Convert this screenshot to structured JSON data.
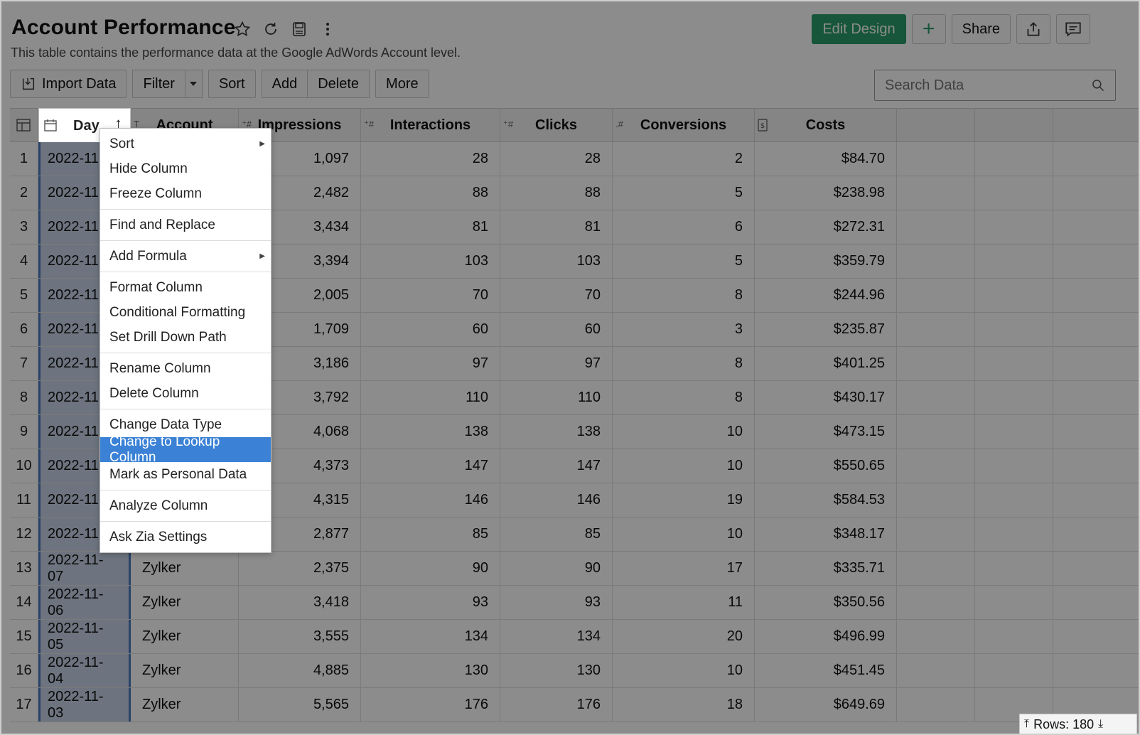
{
  "header": {
    "title": "Account Performance",
    "subtitle": "This table contains the performance data at the Google AdWords Account level."
  },
  "top_actions": {
    "edit_design": "Edit Design",
    "add": "+",
    "share": "Share"
  },
  "toolbar": {
    "import_data": "Import Data",
    "filter": "Filter",
    "sort": "Sort",
    "add": "Add",
    "delete": "Delete",
    "more": "More"
  },
  "search": {
    "placeholder": "Search Data"
  },
  "columns": {
    "day": "Day",
    "account": "Account",
    "impressions": "Impressions",
    "interactions": "Interactions",
    "clicks": "Clicks",
    "conversions": "Conversions",
    "costs": "Costs"
  },
  "rows": [
    {
      "idx": "1",
      "day": "2022-11",
      "acct": "",
      "imp": "1,097",
      "int": "28",
      "clk": "28",
      "conv": "2",
      "cost": "$84.70"
    },
    {
      "idx": "2",
      "day": "2022-11",
      "acct": "",
      "imp": "2,482",
      "int": "88",
      "clk": "88",
      "conv": "5",
      "cost": "$238.98"
    },
    {
      "idx": "3",
      "day": "2022-11",
      "acct": "",
      "imp": "3,434",
      "int": "81",
      "clk": "81",
      "conv": "6",
      "cost": "$272.31"
    },
    {
      "idx": "4",
      "day": "2022-11",
      "acct": "",
      "imp": "3,394",
      "int": "103",
      "clk": "103",
      "conv": "5",
      "cost": "$359.79"
    },
    {
      "idx": "5",
      "day": "2022-11",
      "acct": "",
      "imp": "2,005",
      "int": "70",
      "clk": "70",
      "conv": "8",
      "cost": "$244.96"
    },
    {
      "idx": "6",
      "day": "2022-11",
      "acct": "",
      "imp": "1,709",
      "int": "60",
      "clk": "60",
      "conv": "3",
      "cost": "$235.87"
    },
    {
      "idx": "7",
      "day": "2022-11",
      "acct": "",
      "imp": "3,186",
      "int": "97",
      "clk": "97",
      "conv": "8",
      "cost": "$401.25"
    },
    {
      "idx": "8",
      "day": "2022-11",
      "acct": "",
      "imp": "3,792",
      "int": "110",
      "clk": "110",
      "conv": "8",
      "cost": "$430.17"
    },
    {
      "idx": "9",
      "day": "2022-11",
      "acct": "",
      "imp": "4,068",
      "int": "138",
      "clk": "138",
      "conv": "10",
      "cost": "$473.15"
    },
    {
      "idx": "10",
      "day": "2022-11",
      "acct": "",
      "imp": "4,373",
      "int": "147",
      "clk": "147",
      "conv": "10",
      "cost": "$550.65"
    },
    {
      "idx": "11",
      "day": "2022-11",
      "acct": "",
      "imp": "4,315",
      "int": "146",
      "clk": "146",
      "conv": "19",
      "cost": "$584.53"
    },
    {
      "idx": "12",
      "day": "2022-11",
      "acct": "",
      "imp": "2,877",
      "int": "85",
      "clk": "85",
      "conv": "10",
      "cost": "$348.17"
    },
    {
      "idx": "13",
      "day": "2022-11-07",
      "acct": "Zylker",
      "imp": "2,375",
      "int": "90",
      "clk": "90",
      "conv": "17",
      "cost": "$335.71"
    },
    {
      "idx": "14",
      "day": "2022-11-06",
      "acct": "Zylker",
      "imp": "3,418",
      "int": "93",
      "clk": "93",
      "conv": "11",
      "cost": "$350.56"
    },
    {
      "idx": "15",
      "day": "2022-11-05",
      "acct": "Zylker",
      "imp": "3,555",
      "int": "134",
      "clk": "134",
      "conv": "20",
      "cost": "$496.99"
    },
    {
      "idx": "16",
      "day": "2022-11-04",
      "acct": "Zylker",
      "imp": "4,885",
      "int": "130",
      "clk": "130",
      "conv": "10",
      "cost": "$451.45"
    },
    {
      "idx": "17",
      "day": "2022-11-03",
      "acct": "Zylker",
      "imp": "5,565",
      "int": "176",
      "clk": "176",
      "conv": "18",
      "cost": "$649.69"
    }
  ],
  "context_menu": {
    "sort": "Sort",
    "hide_column": "Hide Column",
    "freeze_column": "Freeze Column",
    "find_replace": "Find and Replace",
    "add_formula": "Add Formula",
    "format_column": "Format Column",
    "conditional_formatting": "Conditional Formatting",
    "drill_down": "Set Drill Down Path",
    "rename_column": "Rename Column",
    "delete_column": "Delete Column",
    "change_data_type": "Change Data Type",
    "change_lookup": "Change to Lookup Column",
    "mark_personal": "Mark as Personal Data",
    "analyze_column": "Analyze Column",
    "zia_settings": "Ask Zia Settings"
  },
  "footer": {
    "rows": "Rows: 180"
  },
  "colors": {
    "accent": "#2a9d6b",
    "menu_active": "#3b82d6",
    "column_selected": "#4b79bd"
  }
}
